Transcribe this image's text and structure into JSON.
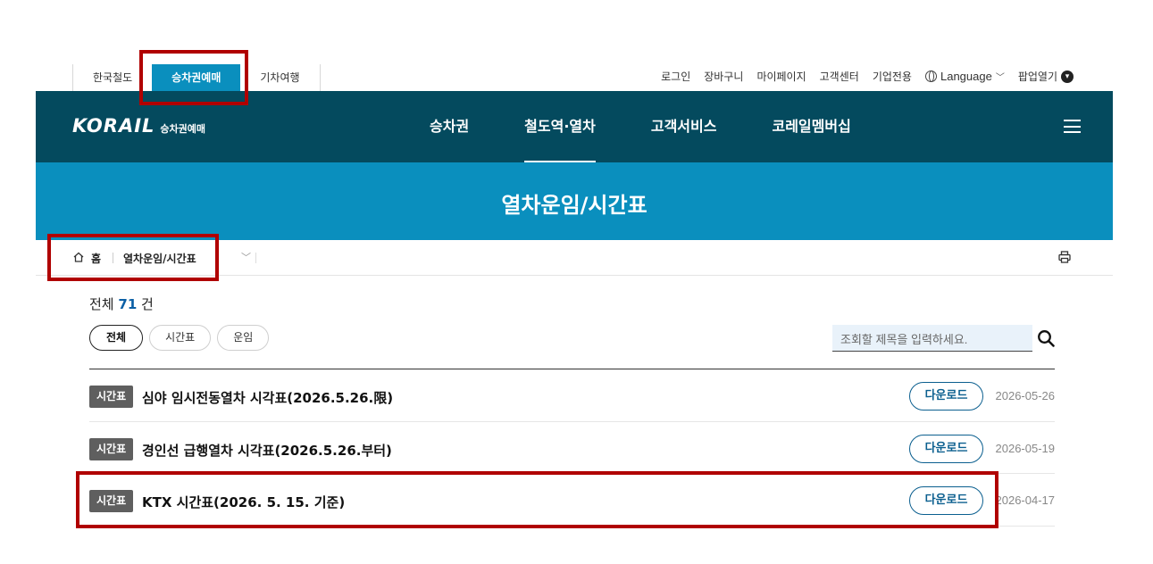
{
  "util": {
    "tabs": [
      "한국철도",
      "승차권예매",
      "기차여행"
    ],
    "links": [
      "로그인",
      "장바구니",
      "마이페이지",
      "고객센터",
      "기업전용"
    ],
    "language": "Language",
    "popup": "팝업열기"
  },
  "nav": {
    "logo": "KORAIL",
    "logo_sub": "승차권예매",
    "items": [
      "승차권",
      "철도역·열차",
      "고객서비스",
      "코레일멤버십"
    ]
  },
  "banner": {
    "title": "열차운임/시간표"
  },
  "breadcrumb": {
    "home": "홈",
    "current": "열차운임/시간표"
  },
  "summary": {
    "prefix": "전체",
    "count": "71",
    "suffix": "건"
  },
  "filters": [
    "전체",
    "시간표",
    "운임"
  ],
  "search": {
    "placeholder": "조회할 제목을 입력하세요."
  },
  "list": [
    {
      "tag": "시간표",
      "title": "심야 임시전동열차 시각표(2026.5.26.限)",
      "button": "다운로드",
      "date": "2026-05-26"
    },
    {
      "tag": "시간표",
      "title": "경인선 급행열차 시각표(2026.5.26.부터)",
      "button": "다운로드",
      "date": "2026-05-19"
    },
    {
      "tag": "시간표",
      "title": "KTX 시간표(2026. 5. 15. 기준)",
      "button": "다운로드",
      "date": "2026-04-17"
    }
  ],
  "colors": {
    "nav_bg": "#044a5e",
    "accent": "#0a8fbe",
    "highlight": "#b00000"
  }
}
